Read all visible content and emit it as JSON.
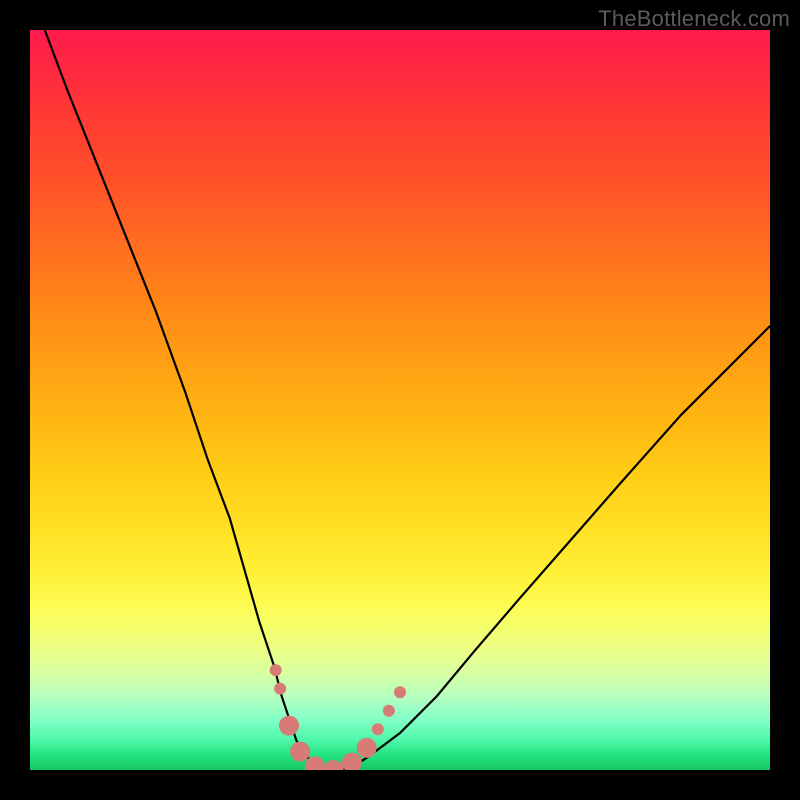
{
  "watermark": "TheBottleneck.com",
  "chart_data": {
    "type": "line",
    "title": "",
    "xlabel": "",
    "ylabel": "",
    "xlim": [
      0,
      100
    ],
    "ylim": [
      0,
      100
    ],
    "grid": false,
    "legend": false,
    "series": [
      {
        "name": "curve",
        "color": "#000000",
        "x": [
          2,
          5,
          9,
          13,
          17,
          21,
          24,
          27,
          29,
          31,
          33,
          34,
          35,
          36,
          37,
          40,
          43,
          46,
          50,
          55,
          60,
          66,
          73,
          80,
          88,
          96,
          100
        ],
        "y": [
          100,
          92,
          82,
          72,
          62,
          51,
          42,
          34,
          27,
          20,
          14,
          10,
          7,
          4,
          2,
          0,
          0,
          2,
          5,
          10,
          16,
          23,
          31,
          39,
          48,
          56,
          60
        ]
      }
    ],
    "markers": {
      "name": "highlight-dots",
      "color": "#d77b77",
      "radius_small": 6,
      "radius_large": 10,
      "points": [
        {
          "x": 33.2,
          "y": 13.5,
          "r": "small"
        },
        {
          "x": 33.8,
          "y": 11.0,
          "r": "small"
        },
        {
          "x": 35.0,
          "y": 6.0,
          "r": "large"
        },
        {
          "x": 36.5,
          "y": 2.5,
          "r": "large"
        },
        {
          "x": 38.5,
          "y": 0.5,
          "r": "large"
        },
        {
          "x": 41.0,
          "y": 0.0,
          "r": "large"
        },
        {
          "x": 43.5,
          "y": 1.0,
          "r": "large"
        },
        {
          "x": 45.5,
          "y": 3.0,
          "r": "large"
        },
        {
          "x": 47.0,
          "y": 5.5,
          "r": "small"
        },
        {
          "x": 48.5,
          "y": 8.0,
          "r": "small"
        },
        {
          "x": 50.0,
          "y": 10.5,
          "r": "small"
        }
      ]
    },
    "background_gradient": {
      "top": "#ff1a4d",
      "upper_mid": "#ff9c14",
      "mid": "#fff23a",
      "lower_mid": "#b6ffbe",
      "bottom": "#17c95f"
    }
  }
}
